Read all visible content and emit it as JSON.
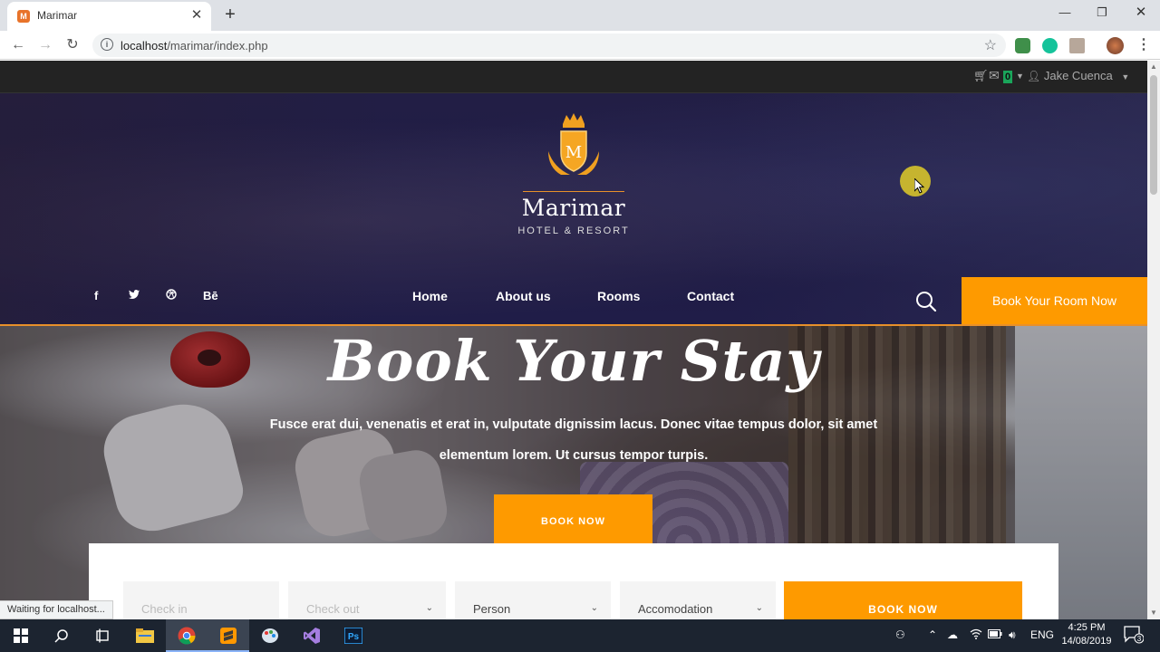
{
  "browser": {
    "tab_title": "Marimar",
    "tab_favicon": "M",
    "url_host": "localhost",
    "url_path": "/marimar/index.php",
    "status_text": "Waiting for localhost..."
  },
  "site": {
    "topbar": {
      "cart_count": "0",
      "user_name": "Jake Cuenca"
    },
    "logo": {
      "letter": "M",
      "name": "Marimar",
      "tagline": "HOTEL & RESORT"
    },
    "social": [
      "f",
      "t",
      "d",
      "Bē"
    ],
    "nav": [
      "Home",
      "About us",
      "Rooms",
      "Contact"
    ],
    "book_room_button": "Book Your Room Now",
    "hero": {
      "title": "Book Your Stay",
      "subtitle": "Fusce erat dui, venenatis et erat in, vulputate dignissim lacus. Donec vitae tempus dolor, sit amet elementum lorem. Ut cursus tempor turpis.",
      "button": "BOOK NOW"
    },
    "booking": {
      "check_in": "Check in",
      "check_out": "Check out",
      "person": "Person",
      "accomodation": "Accomodation",
      "button": "BOOK NOW"
    }
  },
  "taskbar": {
    "language": "ENG",
    "time": "4:25 PM",
    "date": "14/08/2019",
    "notifications": "3"
  },
  "colors": {
    "accent": "#fe9a00",
    "navy": "#1e1b44",
    "topbar": "#232323"
  }
}
